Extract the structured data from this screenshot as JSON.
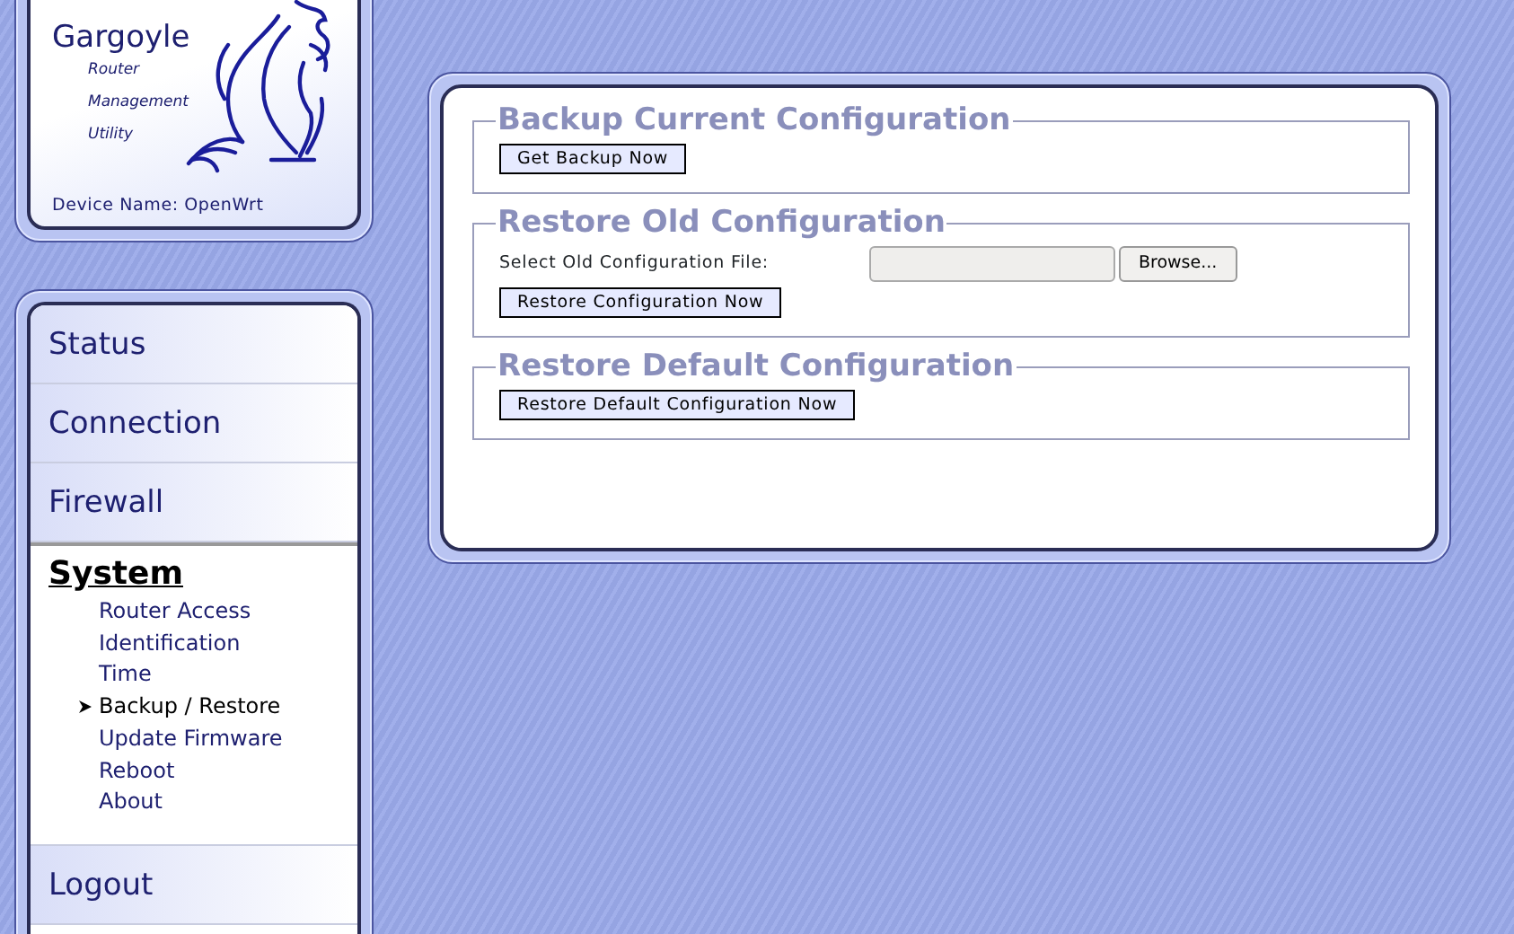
{
  "header": {
    "title": "Gargoyle",
    "subtitle_lines": [
      "Router",
      "Management",
      "Utility"
    ],
    "device_name": "Device Name: OpenWrt"
  },
  "nav": {
    "items": [
      {
        "label": "Status",
        "selected": false
      },
      {
        "label": "Connection",
        "selected": false
      },
      {
        "label": "Firewall",
        "selected": false
      },
      {
        "label": "System",
        "selected": true,
        "children": [
          {
            "label": "Router Access",
            "selected": false
          },
          {
            "label": "Identification",
            "selected": false
          },
          {
            "label": "Time",
            "selected": false
          },
          {
            "label": "Backup / Restore",
            "selected": true
          },
          {
            "label": "Update Firmware",
            "selected": false
          },
          {
            "label": "Reboot",
            "selected": false
          },
          {
            "label": "About",
            "selected": false
          }
        ]
      },
      {
        "label": "Logout",
        "selected": false
      }
    ]
  },
  "sections": [
    {
      "title": "Backup Current Configuration",
      "controls": [
        {
          "kind": "button",
          "label": "Get Backup Now"
        }
      ]
    },
    {
      "title": "Restore Old Configuration",
      "controls": [
        {
          "kind": "file",
          "label": "Select Old Configuration File:",
          "browse": "Browse..."
        },
        {
          "kind": "button",
          "label": "Restore Configuration Now"
        }
      ]
    },
    {
      "title": "Restore Default Configuration",
      "controls": [
        {
          "kind": "button",
          "label": "Restore Default Configuration Now"
        }
      ]
    }
  ]
}
